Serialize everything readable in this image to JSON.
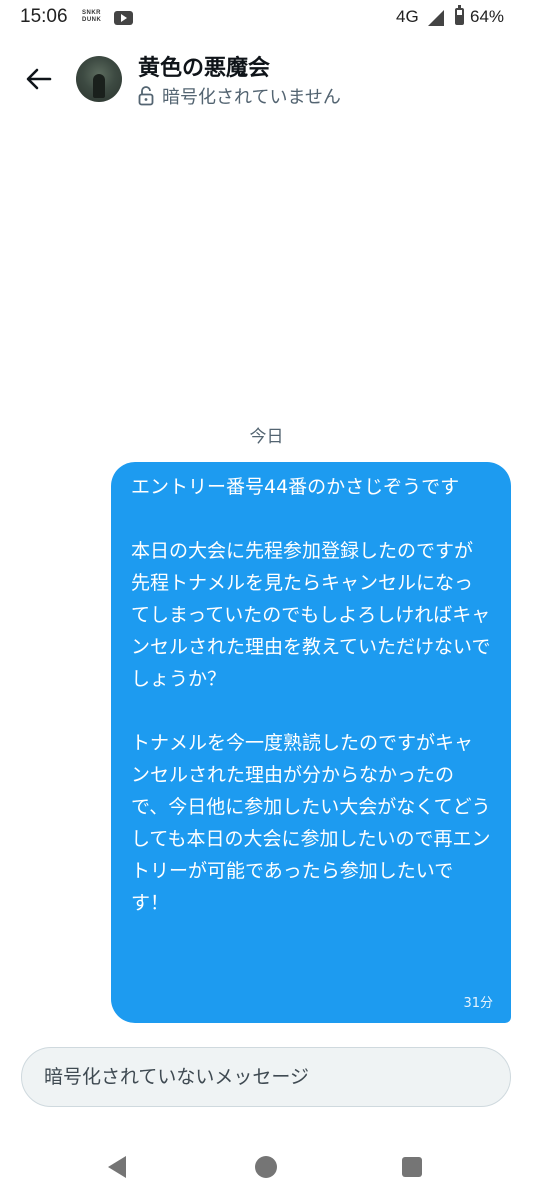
{
  "status_bar": {
    "time": "15:06",
    "sneaker_app_label": "SNKR DUNK",
    "network": "4G",
    "battery": "64%",
    "battery_level": 0.64,
    "icons": [
      "sneaker-dunk-icon",
      "youtube-icon",
      "signal-icon",
      "battery-icon"
    ]
  },
  "header": {
    "title": "黄色の悪魔会",
    "subtitle": "暗号化されていません",
    "icons": [
      "back-arrow-icon",
      "lock-open-icon"
    ]
  },
  "conversation": {
    "date_label": "今日",
    "messages": [
      {
        "text": "エントリー番号44番のかさじぞうです\n\n本日の大会に先程参加登録したのですが先程トナメルを見たらキャンセルになってしまっていたのでもしよろしければキャンセルされた理由を教えていただけないでしょうか？\n\nトナメルを今一度熟読したのですがキャンセルされた理由が分からなかったので、今日他に参加したい大会がなくてどうしても本日の大会に参加したいので再エントリーが可能であったら参加したいです！",
        "time": "31分",
        "bubble_color": "#1d9bf0"
      }
    ]
  },
  "composer": {
    "placeholder": "暗号化されていないメッセージ",
    "value": ""
  },
  "nav_bar": {
    "icons": [
      "nav-back-icon",
      "nav-home-icon",
      "nav-recents-icon"
    ]
  },
  "colors": {
    "accent": "#1d9bf0",
    "muted_text": "#536471",
    "input_bg": "#eff3f4"
  }
}
